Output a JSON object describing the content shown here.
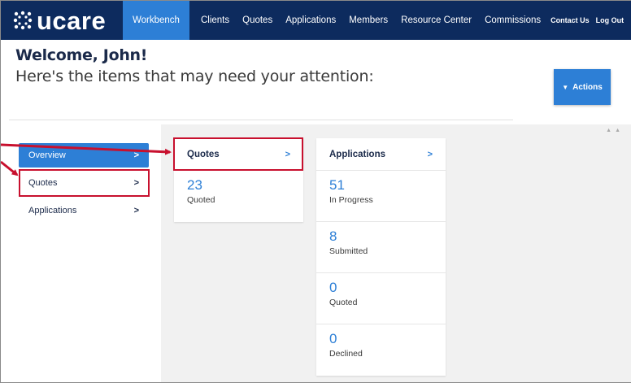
{
  "nav": {
    "logo": "ucare",
    "items": [
      "Workbench",
      "Clients",
      "Quotes",
      "Applications",
      "Members",
      "Resource Center",
      "Commissions"
    ],
    "contact": "Contact Us",
    "logout": "Log Out"
  },
  "header": {
    "welcome": "Welcome, John!",
    "subtitle": "Here's the items that may need your attention:",
    "actions_label": "Actions"
  },
  "sidebar": {
    "items": [
      {
        "label": "Overview"
      },
      {
        "label": "Quotes"
      },
      {
        "label": "Applications"
      }
    ]
  },
  "cards": {
    "quotes": {
      "title": "Quotes",
      "stats": [
        {
          "value": "23",
          "label": "Quoted"
        }
      ]
    },
    "applications": {
      "title": "Applications",
      "stats": [
        {
          "value": "51",
          "label": "In Progress"
        },
        {
          "value": "8",
          "label": "Submitted"
        },
        {
          "value": "0",
          "label": "Quoted"
        },
        {
          "value": "0",
          "label": "Declined"
        }
      ]
    }
  },
  "colors": {
    "nav_bg": "#0d2b5e",
    "accent": "#2d7fd6",
    "highlight": "#c8102e"
  }
}
